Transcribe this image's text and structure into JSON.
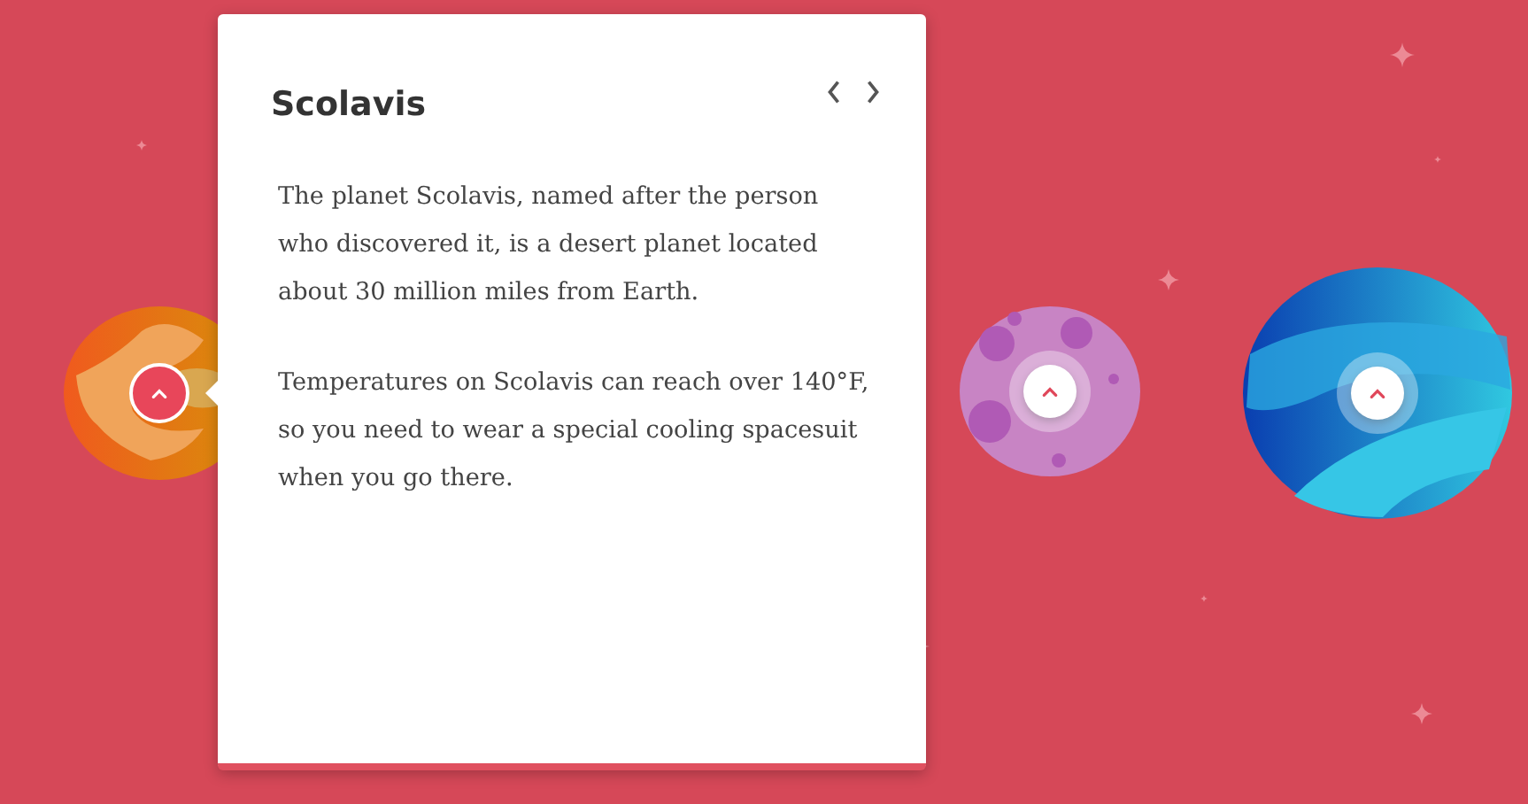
{
  "card": {
    "title": "Scolavis",
    "paragraphs": [
      "The planet Scolavis, named after the person who discovered it, is a desert planet located about 30 million miles from Earth.",
      "Temperatures on Scolavis can reach over 140°F, so you need to wear a special cooling spacesuit when you go there."
    ]
  },
  "planets": [
    {
      "kind": "desert",
      "selected": true
    },
    {
      "kind": "spotted",
      "selected": false
    },
    {
      "kind": "ocean",
      "selected": false
    }
  ]
}
